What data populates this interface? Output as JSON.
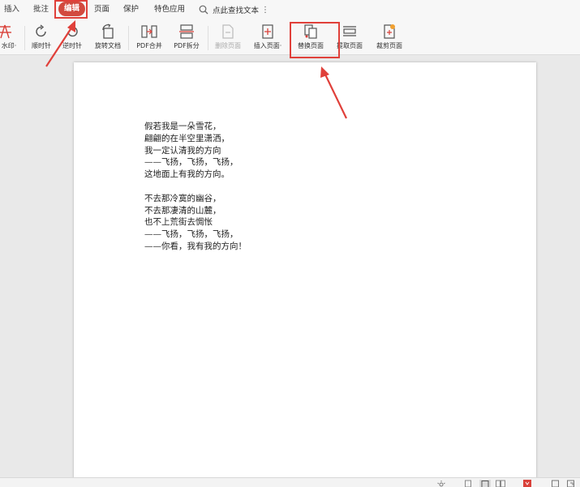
{
  "menu": {
    "items": [
      "插入",
      "批注",
      "编辑",
      "页面",
      "保护",
      "特色应用"
    ],
    "active": "编辑",
    "search_label": "点此查找文本",
    "more_glyph": "⋮"
  },
  "ribbon": {
    "partial_label": "水印·",
    "clockwise": "顺时针",
    "counterclockwise": "逆时针",
    "rotate_doc": "旋转文档",
    "pdf_merge": "PDF合并",
    "pdf_split": "PDF拆分",
    "delete_page": "删除页面",
    "insert_page": "插入页面·",
    "replace_page": "替换页面",
    "extract_page": "提取页面",
    "crop_page": "裁剪页面"
  },
  "document": {
    "stanza1": [
      "假若我是一朵雪花，",
      "翩翩的在半空里潇洒，",
      "我一定认清我的方向",
      "——飞扬，飞扬，飞扬，",
      "这地面上有我的方向。"
    ],
    "stanza2": [
      "不去那冷寞的幽谷，",
      "不去那凄清的山麓，",
      "也不上荒街去惆怅",
      "——飞扬，飞扬，飞扬，",
      "——你看，我有我的方向！"
    ]
  },
  "colors": {
    "accent": "#d2493e",
    "annotation": "#e0403a",
    "icon_red": "#d9413a"
  }
}
